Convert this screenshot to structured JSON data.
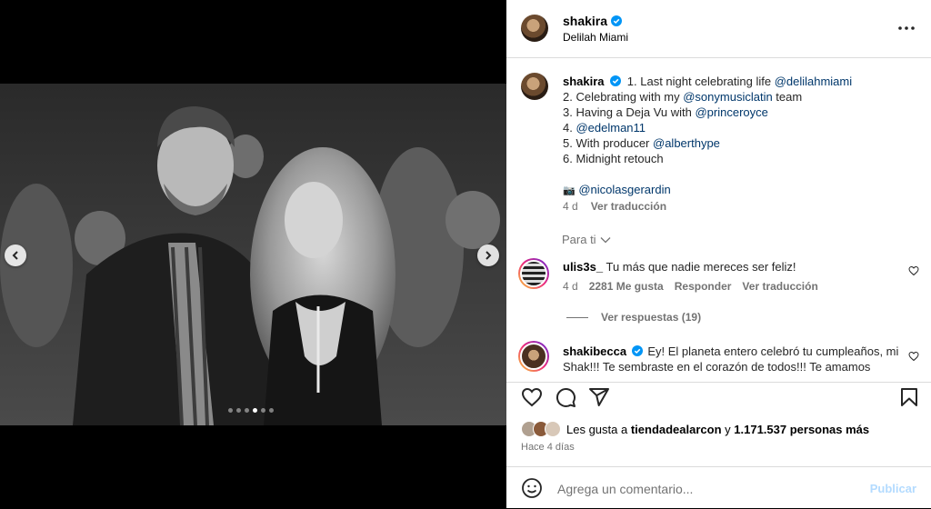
{
  "post": {
    "username": "shakira",
    "location": "Delilah Miami",
    "verified": true,
    "carousel": {
      "total": 6,
      "active": 4
    }
  },
  "caption": {
    "username": "shakira",
    "line1_text": "1. Last night celebrating life ",
    "line1_mention": "@delilahmiami",
    "line2_text": "2. Celebrating with my ",
    "line2_mention": "@sonymusiclatin",
    "line2_after": " team",
    "line3_text": "3. Having a Deja Vu with ",
    "line3_mention": "@princeroyce",
    "line4_text": "4. ",
    "line4_mention": "@edelman11",
    "line5_text": "5. With producer ",
    "line5_mention": "@alberthype",
    "line6_text": "6. Midnight retouch",
    "credit_emoji": "📷",
    "credit_mention": "@nicolasgerardin",
    "time": "4 d",
    "translate": "Ver traducción"
  },
  "filter": {
    "label": "Para ti"
  },
  "comments": [
    {
      "username": "ulis3s_",
      "text": "Tu más que nadie mereces ser feliz!",
      "time": "4 d",
      "likes": "2281 Me gusta",
      "reply": "Responder",
      "translate": "Ver traducción",
      "view_replies": "Ver respuestas (19)"
    },
    {
      "username": "shakibecca",
      "verified": true,
      "text": "Ey! El planeta entero celebró tu cumpleaños, mi Shak!!! Te sembraste en el corazón de todos!!! Te amamos"
    }
  ],
  "likes": {
    "prefix": "Les gusta a ",
    "user": "tiendadealarcon",
    "middle": " y ",
    "count": "1.171.537 personas más"
  },
  "time_ago": "Hace 4 días",
  "add_comment": {
    "placeholder": "Agrega un comentario...",
    "publish": "Publicar"
  },
  "icons": {
    "verified": "verified-badge-icon",
    "more": "more-options-icon",
    "like": "heart-icon",
    "comment": "comment-icon",
    "share": "share-icon",
    "save": "bookmark-icon",
    "emoji": "emoji-icon"
  },
  "colors": {
    "verified": "#0095f6",
    "mention": "#00376b",
    "secondary_text": "#737373",
    "publish_disabled": "#b3dbff",
    "divider": "#dbdbdb"
  }
}
